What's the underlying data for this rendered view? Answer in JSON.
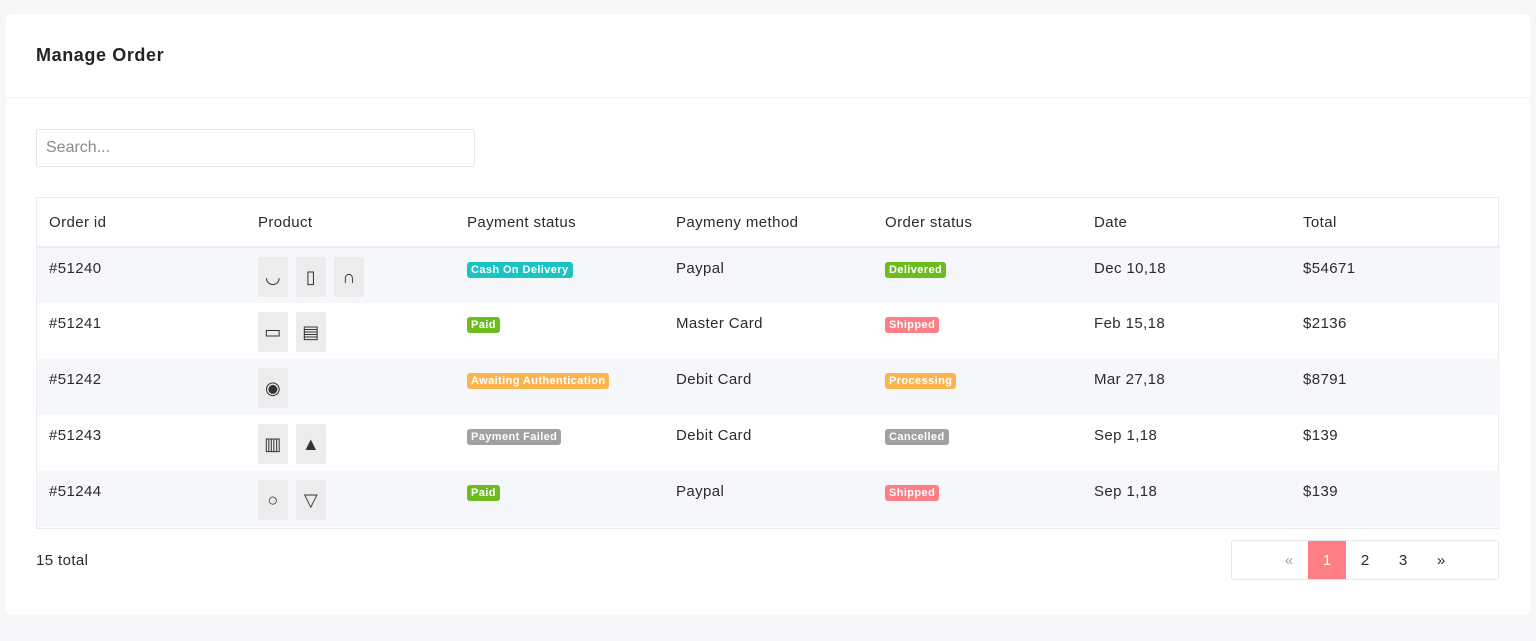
{
  "title": "Manage Order",
  "search": {
    "placeholder": "Search..."
  },
  "columns": [
    "Order id",
    "Product",
    "Payment status",
    "Paymeny method",
    "Order status",
    "Date",
    "Total"
  ],
  "colors": {
    "cash_on_delivery": "#1bc4c4",
    "paid": "#6cbb1f",
    "awaiting": "#fbb550",
    "failed": "#a0a0a0",
    "delivered": "#6cbb1f",
    "shipped": "#fd7e85",
    "processing": "#fbb550",
    "cancelled": "#a0a0a0",
    "active_page": "#fd7e85"
  },
  "orders": [
    {
      "id": "#51240",
      "products": [
        "headset-icon",
        "smartphone-icon",
        "headphones-icon"
      ],
      "payment_status": "Cash On Delivery",
      "payment_color": "#1bc4c4",
      "payment_method": "Paypal",
      "order_status": "Delivered",
      "order_color": "#6cbb1f",
      "date": "Dec 10,18",
      "total": "$54671"
    },
    {
      "id": "#51241",
      "products": [
        "monitor-icon",
        "printer-icon"
      ],
      "payment_status": "Paid",
      "payment_color": "#6cbb1f",
      "payment_method": "Master Card",
      "order_status": "Shipped",
      "order_color": "#fd7e85",
      "date": "Feb 15,18",
      "total": "$2136"
    },
    {
      "id": "#51242",
      "products": [
        "camera-icon"
      ],
      "payment_status": "Awaiting Authentication",
      "payment_color": "#fbb550",
      "payment_method": "Debit Card",
      "order_status": "Processing",
      "order_color": "#fbb550",
      "date": "Mar 27,18",
      "total": "$8791"
    },
    {
      "id": "#51243",
      "products": [
        "coffee-maker-icon",
        "lamp-icon"
      ],
      "payment_status": "Payment Failed",
      "payment_color": "#a0a0a0",
      "payment_method": "Debit Card",
      "order_status": "Cancelled",
      "order_color": "#a0a0a0",
      "date": "Sep 1,18",
      "total": "$139"
    },
    {
      "id": "#51244",
      "products": [
        "ring-icon",
        "dress-icon"
      ],
      "payment_status": "Paid",
      "payment_color": "#6cbb1f",
      "payment_method": "Paypal",
      "order_status": "Shipped",
      "order_color": "#fd7e85",
      "date": "Sep 1,18",
      "total": "$139"
    }
  ],
  "footer": {
    "total_label": "15 total"
  },
  "pagination": {
    "prev": "«",
    "pages": [
      "1",
      "2",
      "3"
    ],
    "active": "1",
    "next": "»"
  }
}
